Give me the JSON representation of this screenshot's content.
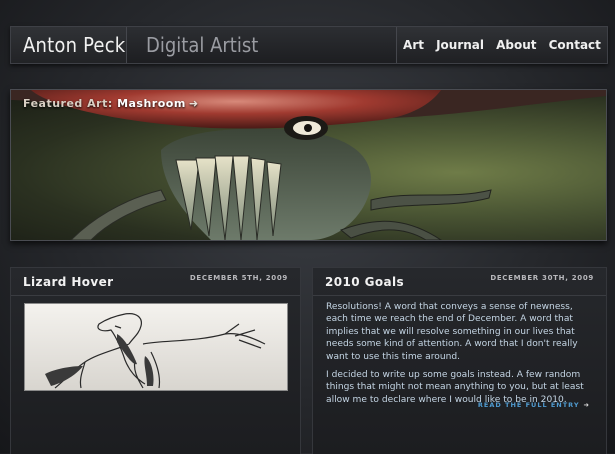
{
  "header": {
    "name": "Anton Peck",
    "tagline": "Digital Artist",
    "nav": [
      "Art",
      "Journal",
      "About",
      "Contact"
    ]
  },
  "hero": {
    "prefix": "Featured Art: ",
    "title": "Mashroom",
    "arrow_icon": "arrow-right-icon"
  },
  "left_panel": {
    "title": "Lizard Hover",
    "date": "DECEMBER 5TH, 2009"
  },
  "right_panel": {
    "title": "2010 Goals",
    "date": "DECEMBER 30TH, 2009",
    "paragraph1": "Resolutions! A word that conveys a sense of newness, each time we reach the end of December. A word that implies that we will resolve something in our lives that needs some kind of attention. A word that I don't really want to use this time around.",
    "paragraph2": "I decided to write up some goals instead. A few random things that might not mean anything to you, but at least allow me to declare where I would like to be in 2010.",
    "read_more": "READ THE FULL ENTRY"
  },
  "colors": {
    "link": "#4f9bd0",
    "body_text": "#c4d5e4"
  }
}
